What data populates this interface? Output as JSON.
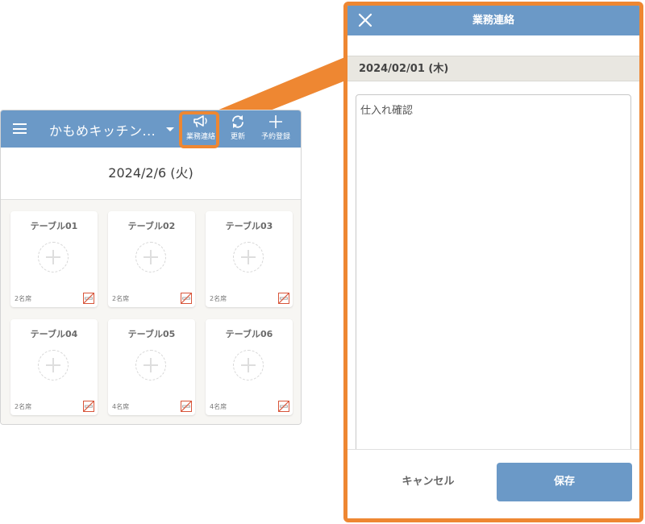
{
  "app": {
    "store_name": "かもめキッチン...",
    "buttons": {
      "notice": {
        "label": "業務連絡",
        "icon": "megaphone-icon"
      },
      "refresh": {
        "label": "更新",
        "icon": "refresh-icon"
      },
      "reserve": {
        "label": "予約登録",
        "icon": "plus-icon"
      }
    },
    "date": "2024/2/6 (火)",
    "tables": [
      {
        "name": "テーブル01",
        "seats": "2名席",
        "icon": "no-smoking-icon"
      },
      {
        "name": "テーブル02",
        "seats": "2名席",
        "icon": "no-smoking-icon"
      },
      {
        "name": "テーブル03",
        "seats": "2名席",
        "icon": "no-smoking-icon"
      },
      {
        "name": "テーブル04",
        "seats": "2名席",
        "icon": "no-smoking-icon"
      },
      {
        "name": "テーブル05",
        "seats": "4名席",
        "icon": "no-smoking-icon"
      },
      {
        "name": "テーブル06",
        "seats": "4名席",
        "icon": "no-smoking-icon"
      }
    ]
  },
  "modal": {
    "title": "業務連絡",
    "date": "2024/02/01 (木)",
    "memo_value": "仕入れ確認",
    "cancel_label": "キャンセル",
    "save_label": "保存"
  },
  "colors": {
    "accent": "#6b99c7",
    "highlight": "#ee8732",
    "no_smoking_red": "#d8553a"
  }
}
